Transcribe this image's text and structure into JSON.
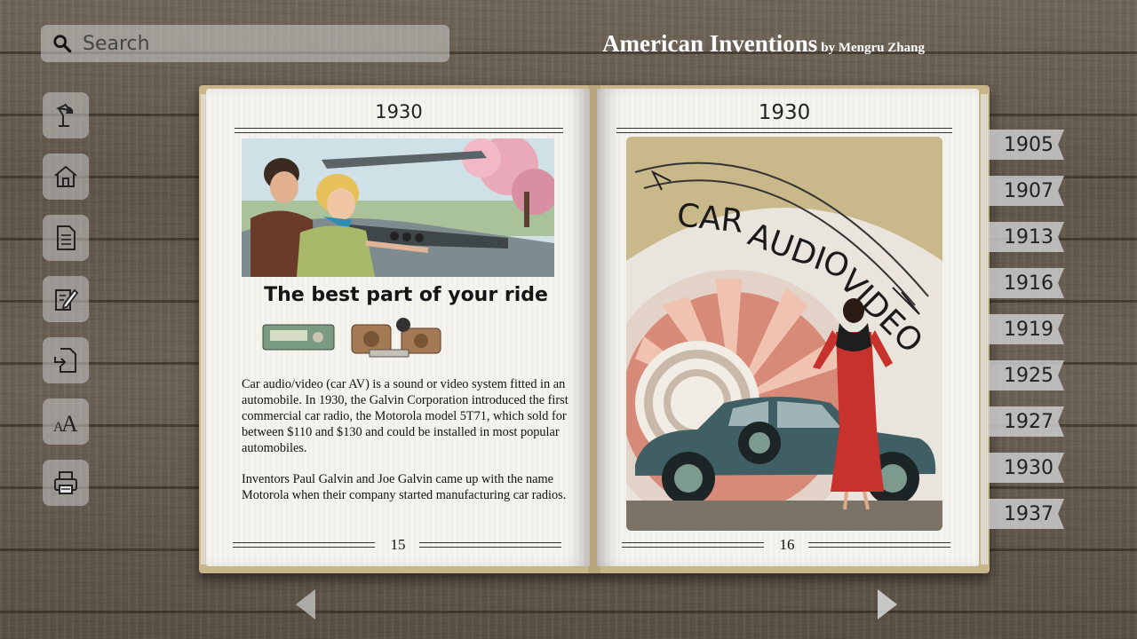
{
  "header": {
    "search_placeholder": "Search",
    "title": "American Inventions",
    "byline": "by Mengru Zhang"
  },
  "sidebar": {
    "items": [
      {
        "icon": "lamp-icon"
      },
      {
        "icon": "home-icon"
      },
      {
        "icon": "document-icon"
      },
      {
        "icon": "edit-note-icon"
      },
      {
        "icon": "import-document-icon"
      },
      {
        "icon": "font-size-icon"
      },
      {
        "icon": "print-icon"
      }
    ]
  },
  "book": {
    "left_page": {
      "year": "1930",
      "tagline": "The best part of your ride",
      "paragraphs": [
        "Car audio/video (car AV) is a sound or video system fitted in an automobile. In 1930, the Galvin Corporation introduced the first commercial car radio, the Motorola model 5T71, which sold for between $110 and $130 and could be installed in most popular automobiles.",
        "Inventors Paul Galvin and Joe Galvin came up with the name Motorola when their company started manufacturing car radios."
      ],
      "page_number": "15"
    },
    "right_page": {
      "year": "1930",
      "poster_text": "CAR AUDIO VIDEO",
      "page_number": "16"
    }
  },
  "year_tabs": [
    "1905",
    "1907",
    "1913",
    "1916",
    "1919",
    "1925",
    "1927",
    "1930",
    "1937"
  ],
  "navigation": {
    "prev_icon": "arrow-left-icon",
    "next_icon": "arrow-right-icon"
  }
}
